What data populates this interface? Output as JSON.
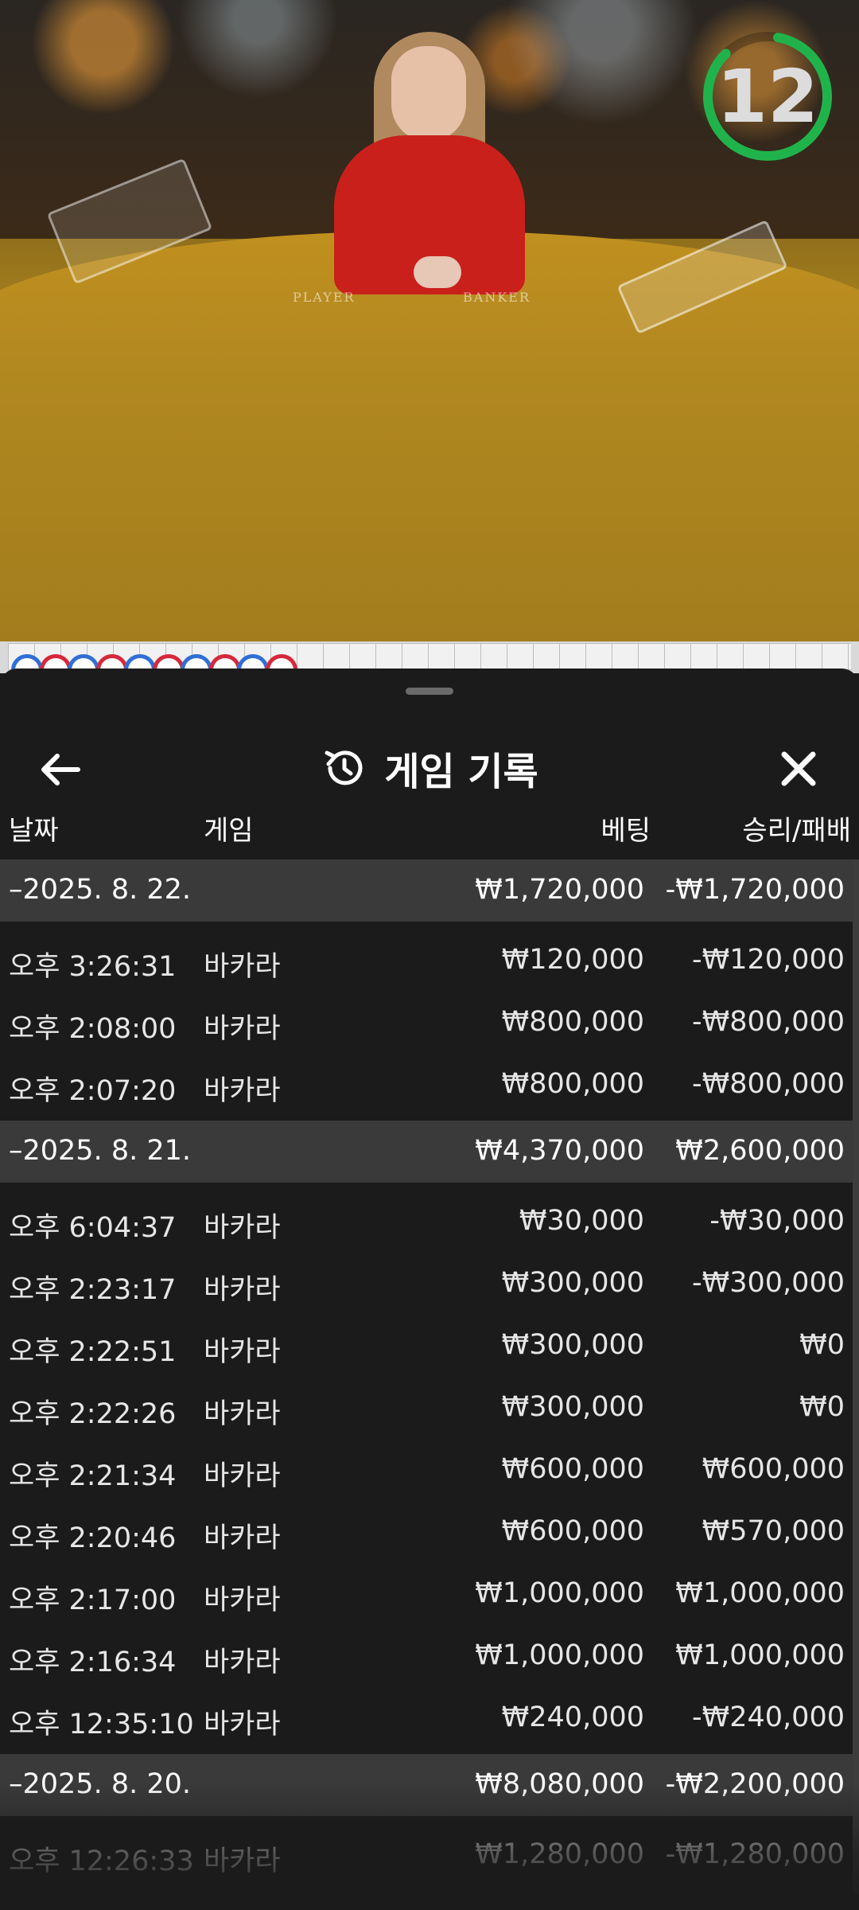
{
  "video": {
    "felt_left": "PLAYER",
    "felt_right": "BANKER",
    "countdown": "12"
  },
  "road": {
    "dots": [
      "blue",
      "red",
      "blue",
      "red",
      "blue",
      "red",
      "blue",
      "red",
      "blue",
      "red"
    ]
  },
  "sheet": {
    "title": "게임 기록",
    "columns": {
      "date": "날짜",
      "game": "게임",
      "bet": "베팅",
      "win_loss": "승리/패배"
    }
  },
  "history": [
    {
      "date": "–2025. 8. 22.",
      "bet_total": "₩1,720,000",
      "win_total": "-₩1,720,000",
      "rows": [
        {
          "time": "오후 3:26:31",
          "game": "바카라",
          "bet": "₩120,000",
          "win": "-₩120,000"
        },
        {
          "time": "오후 2:08:00",
          "game": "바카라",
          "bet": "₩800,000",
          "win": "-₩800,000"
        },
        {
          "time": "오후 2:07:20",
          "game": "바카라",
          "bet": "₩800,000",
          "win": "-₩800,000"
        }
      ]
    },
    {
      "date": "–2025. 8. 21.",
      "bet_total": "₩4,370,000",
      "win_total": "₩2,600,000",
      "rows": [
        {
          "time": "오후 6:04:37",
          "game": "바카라",
          "bet": "₩30,000",
          "win": "-₩30,000"
        },
        {
          "time": "오후 2:23:17",
          "game": "바카라",
          "bet": "₩300,000",
          "win": "-₩300,000"
        },
        {
          "time": "오후 2:22:51",
          "game": "바카라",
          "bet": "₩300,000",
          "win": "₩0"
        },
        {
          "time": "오후 2:22:26",
          "game": "바카라",
          "bet": "₩300,000",
          "win": "₩0"
        },
        {
          "time": "오후 2:21:34",
          "game": "바카라",
          "bet": "₩600,000",
          "win": "₩600,000"
        },
        {
          "time": "오후 2:20:46",
          "game": "바카라",
          "bet": "₩600,000",
          "win": "₩570,000"
        },
        {
          "time": "오후 2:17:00",
          "game": "바카라",
          "bet": "₩1,000,000",
          "win": "₩1,000,000"
        },
        {
          "time": "오후 2:16:34",
          "game": "바카라",
          "bet": "₩1,000,000",
          "win": "₩1,000,000"
        },
        {
          "time": "오후 12:35:10",
          "game": "바카라",
          "bet": "₩240,000",
          "win": "-₩240,000"
        }
      ]
    },
    {
      "date": "–2025. 8. 20.",
      "bet_total": "₩8,080,000",
      "win_total": "-₩2,200,000",
      "rows": [
        {
          "time": "오후 12:26:33",
          "game": "바카라",
          "bet": "₩1,280,000",
          "win": "-₩1,280,000"
        }
      ]
    }
  ],
  "colors": {
    "road_blue": "#2f6fd6",
    "road_red": "#d6283a",
    "timer_green": "#21b34b",
    "sheet_bg": "#1b1b1b",
    "group_bg": "#3a3a3a"
  }
}
